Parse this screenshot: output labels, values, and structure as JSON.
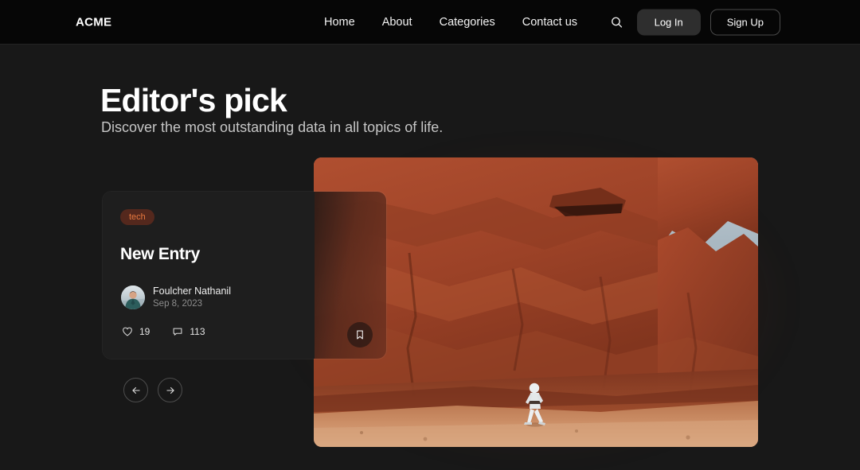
{
  "navbar": {
    "logo": "ACME",
    "links": [
      {
        "label": "Home",
        "name": "nav-link-home"
      },
      {
        "label": "About",
        "name": "nav-link-about"
      },
      {
        "label": "Categories",
        "name": "nav-link-categories"
      },
      {
        "label": "Contact us",
        "name": "nav-link-contact-us"
      }
    ],
    "search_icon": "search-icon",
    "login_label": "Log In",
    "signup_label": "Sign Up"
  },
  "hero": {
    "title": "Editor's pick",
    "subtitle": "Discover the most outstanding data in all topics of life."
  },
  "card": {
    "badge": "tech",
    "title": "New Entry",
    "author_name": "Foulcher Nathanil",
    "author_date": "Sep 8, 2023",
    "likes_icon": "heart-icon",
    "likes": "19",
    "comments_icon": "comment-icon",
    "comments": "113",
    "bookmark_icon": "bookmark-icon"
  },
  "carousel": {
    "prev_icon": "arrow-left-icon",
    "next_icon": "arrow-right-icon"
  },
  "media": {
    "alt": "person walking beside red rock canyon",
    "sky_color": "#b9c5cd",
    "rock_color": "#a0432a",
    "sand_color": "#c98868"
  },
  "colors": {
    "page_bg": "#181818",
    "nav_bg": "#060606",
    "card_bg": "#1e1e1e",
    "badge_bg": "#54281d",
    "badge_text": "#e8793f",
    "accent_glow": "#a03c1e"
  }
}
